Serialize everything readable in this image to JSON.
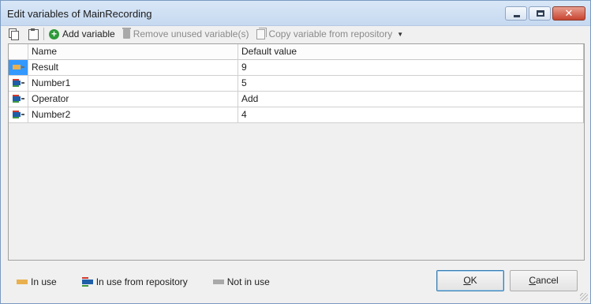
{
  "window": {
    "title": "Edit variables of MainRecording",
    "minimize_icon": "minimize-icon",
    "maximize_icon": "maximize-icon",
    "close_glyph": "✕"
  },
  "toolbar": {
    "copy_icon": "copy-icon",
    "paste_icon": "paste-icon",
    "add_variable": "Add variable",
    "remove_unused": "Remove unused variable(s)",
    "copy_from_repo": "Copy variable from repository",
    "add_glyph": "+",
    "dropdown_glyph": "▼"
  },
  "grid": {
    "headers": [
      "Name",
      "Default value"
    ],
    "rows": [
      {
        "icon": "in-use-variable-icon",
        "name": "Result",
        "value": "9"
      },
      {
        "icon": "repository-variable-icon",
        "name": "Number1",
        "value": "5"
      },
      {
        "icon": "repository-variable-icon",
        "name": "Operator",
        "value": "Add"
      },
      {
        "icon": "repository-variable-icon",
        "name": "Number2",
        "value": "4"
      }
    ]
  },
  "legend": {
    "in_use": "In use",
    "in_use_repo": "In use from repository",
    "not_in_use": "Not in use"
  },
  "buttons": {
    "ok_mnemonic": "O",
    "ok_rest": "K",
    "cancel_mnemonic": "C",
    "cancel_rest": "ancel"
  },
  "colors": {
    "in_use": "#e9b04f",
    "repository": "#1f5ea8",
    "not_in_use": "#a9a9a9",
    "selection": "#3399ff"
  }
}
